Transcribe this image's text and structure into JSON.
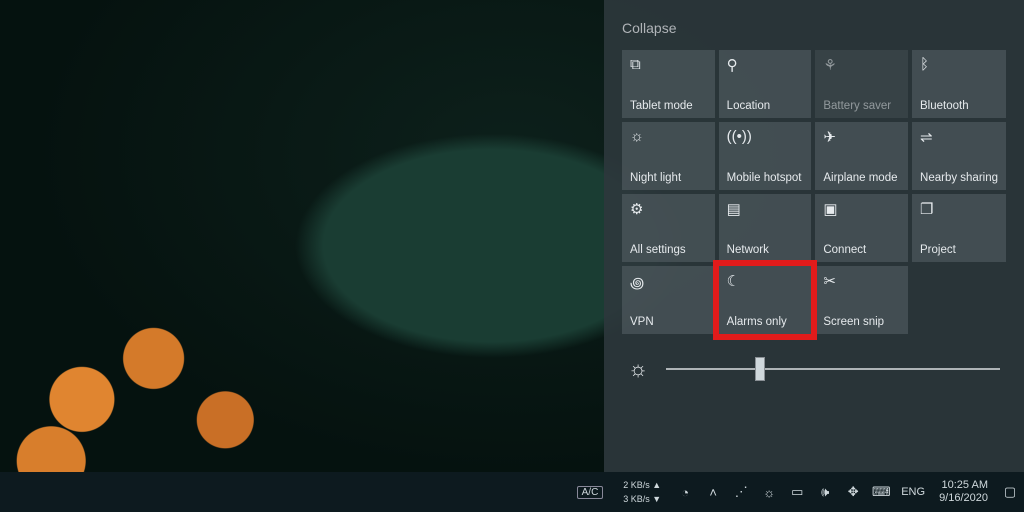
{
  "action_center": {
    "collapse_label": "Collapse",
    "tiles": [
      {
        "label": "Tablet mode",
        "icon": "tablet-mode-icon",
        "glyph": "⧉",
        "interact": true
      },
      {
        "label": "Location",
        "icon": "location-icon",
        "glyph": "⚲",
        "interact": true
      },
      {
        "label": "Battery saver",
        "icon": "battery-saver-icon",
        "glyph": "⚘",
        "interact": false,
        "dim": true
      },
      {
        "label": "Bluetooth",
        "icon": "bluetooth-icon",
        "glyph": "ᛒ",
        "interact": true
      },
      {
        "label": "Night light",
        "icon": "night-light-icon",
        "glyph": "☼",
        "interact": true
      },
      {
        "label": "Mobile hotspot",
        "icon": "mobile-hotspot-icon",
        "glyph": "((•))",
        "interact": true
      },
      {
        "label": "Airplane mode",
        "icon": "airplane-mode-icon",
        "glyph": "✈",
        "interact": true
      },
      {
        "label": "Nearby sharing",
        "icon": "nearby-sharing-icon",
        "glyph": "⇌",
        "interact": true
      },
      {
        "label": "All settings",
        "icon": "settings-icon",
        "glyph": "⚙",
        "interact": true
      },
      {
        "label": "Network",
        "icon": "network-icon",
        "glyph": "▤",
        "interact": true
      },
      {
        "label": "Connect",
        "icon": "connect-icon",
        "glyph": "▣",
        "interact": true
      },
      {
        "label": "Project",
        "icon": "project-icon",
        "glyph": "❐",
        "interact": true
      },
      {
        "label": "VPN",
        "icon": "vpn-icon",
        "glyph": "꩜",
        "interact": true
      },
      {
        "label": "Alarms only",
        "icon": "focus-assist-icon",
        "glyph": "☾",
        "interact": true,
        "highlight": true
      },
      {
        "label": "Screen snip",
        "icon": "screen-snip-icon",
        "glyph": "✂",
        "interact": true
      }
    ],
    "brightness_percent": 28
  },
  "taskbar": {
    "ac_label": "A/C",
    "net_up": "2 KB/s ▲",
    "net_down": "3 KB/s ▼",
    "lang": "ENG",
    "time": "10:25 AM",
    "date": "9/16/2020"
  }
}
